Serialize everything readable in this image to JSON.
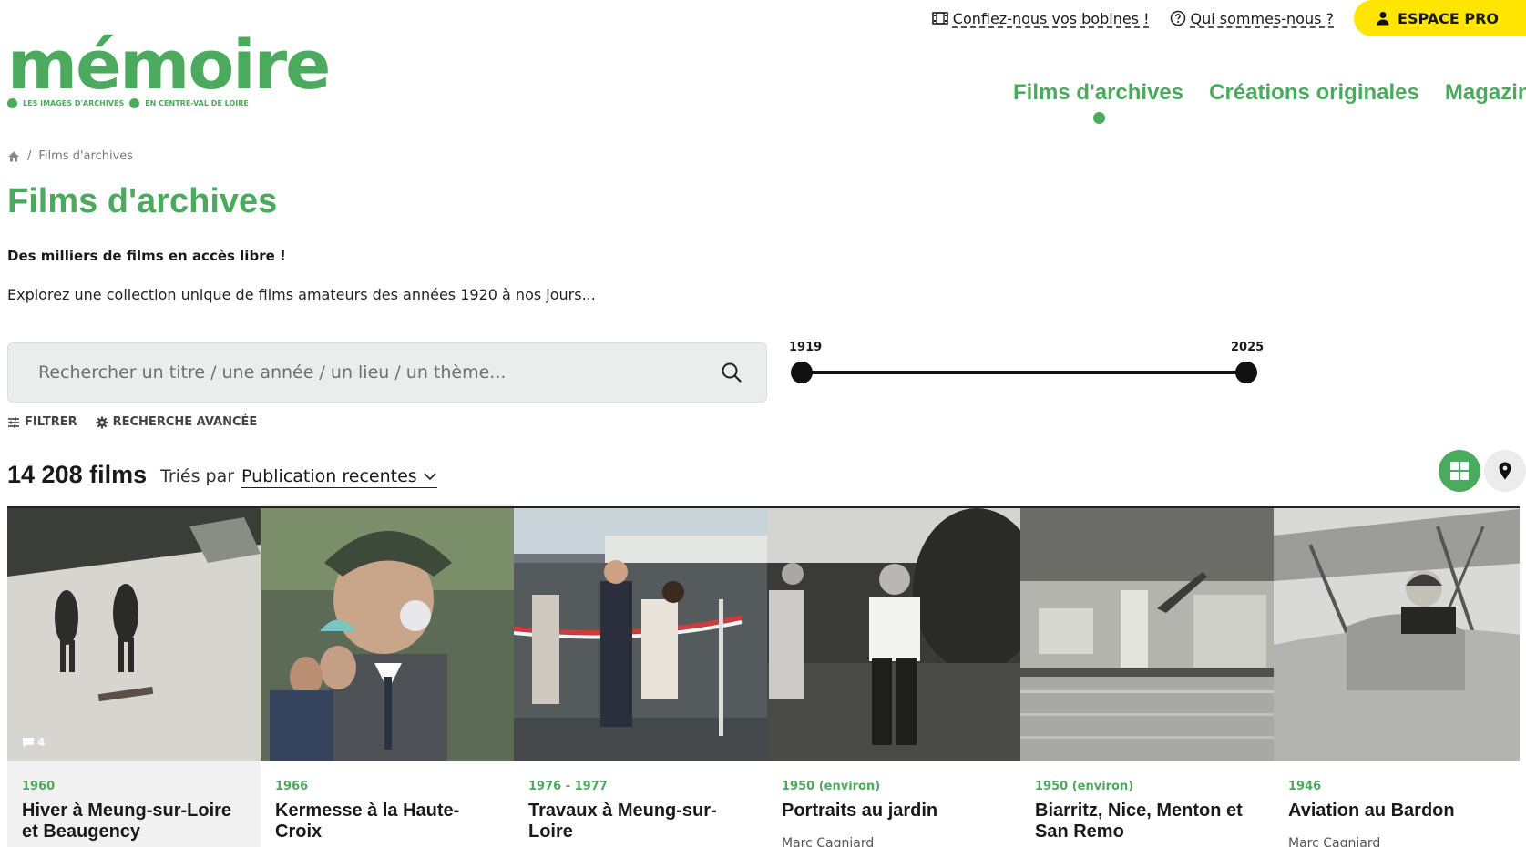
{
  "topbar": {
    "bobines_label": "Confiez-nous vos bobines !",
    "about_label": "Qui sommes-nous ?",
    "pro_label": "ESPACE PRO"
  },
  "logo": {
    "word": "mémoire",
    "tag_left": "LES IMAGES D'ARCHIVES",
    "tag_right": "EN CENTRE-VAL DE LOIRE"
  },
  "nav": {
    "items": [
      {
        "label": "Films d'archives"
      },
      {
        "label": "Créations originales"
      },
      {
        "label": "Magazine"
      }
    ]
  },
  "breadcrumb": {
    "separator": "/",
    "current": "Films d'archives"
  },
  "page": {
    "title": "Films d'archives",
    "tagline": "Des milliers de films en accès libre !",
    "intro": "Explorez une collection unique de films amateurs des années 1920 à nos jours..."
  },
  "search": {
    "placeholder": "Rechercher un titre / une année / un lieu / un thème..."
  },
  "range": {
    "min_label": "1919",
    "max_label": "2025"
  },
  "filters": {
    "filter_label": "FILTRER",
    "advanced_label": "RECHERCHE AVANCÉE"
  },
  "results": {
    "count": "14 208 films",
    "sort_prefix": "Triés par",
    "sort_value": "Publication recentes"
  },
  "films": [
    {
      "year": "1960",
      "title": "Hiver à Meung-sur-Loire et Beaugency",
      "author": "",
      "comments": "4"
    },
    {
      "year": "1966",
      "title": "Kermesse à la Haute-Croix",
      "author": ""
    },
    {
      "year": "1976 - 1977",
      "title": "Travaux à Meung-sur-Loire",
      "author": ""
    },
    {
      "year": "1950 (environ)",
      "title": "Portraits au jardin",
      "author": "Marc Cagniard"
    },
    {
      "year": "1950 (environ)",
      "title": "Biarritz, Nice, Menton et San Remo",
      "author": ""
    },
    {
      "year": "1946",
      "title": "Aviation au Bardon",
      "author": "Marc Cagniard"
    }
  ],
  "colors": {
    "brand_green": "#4caa5e",
    "pro_yellow": "#ffe500"
  }
}
